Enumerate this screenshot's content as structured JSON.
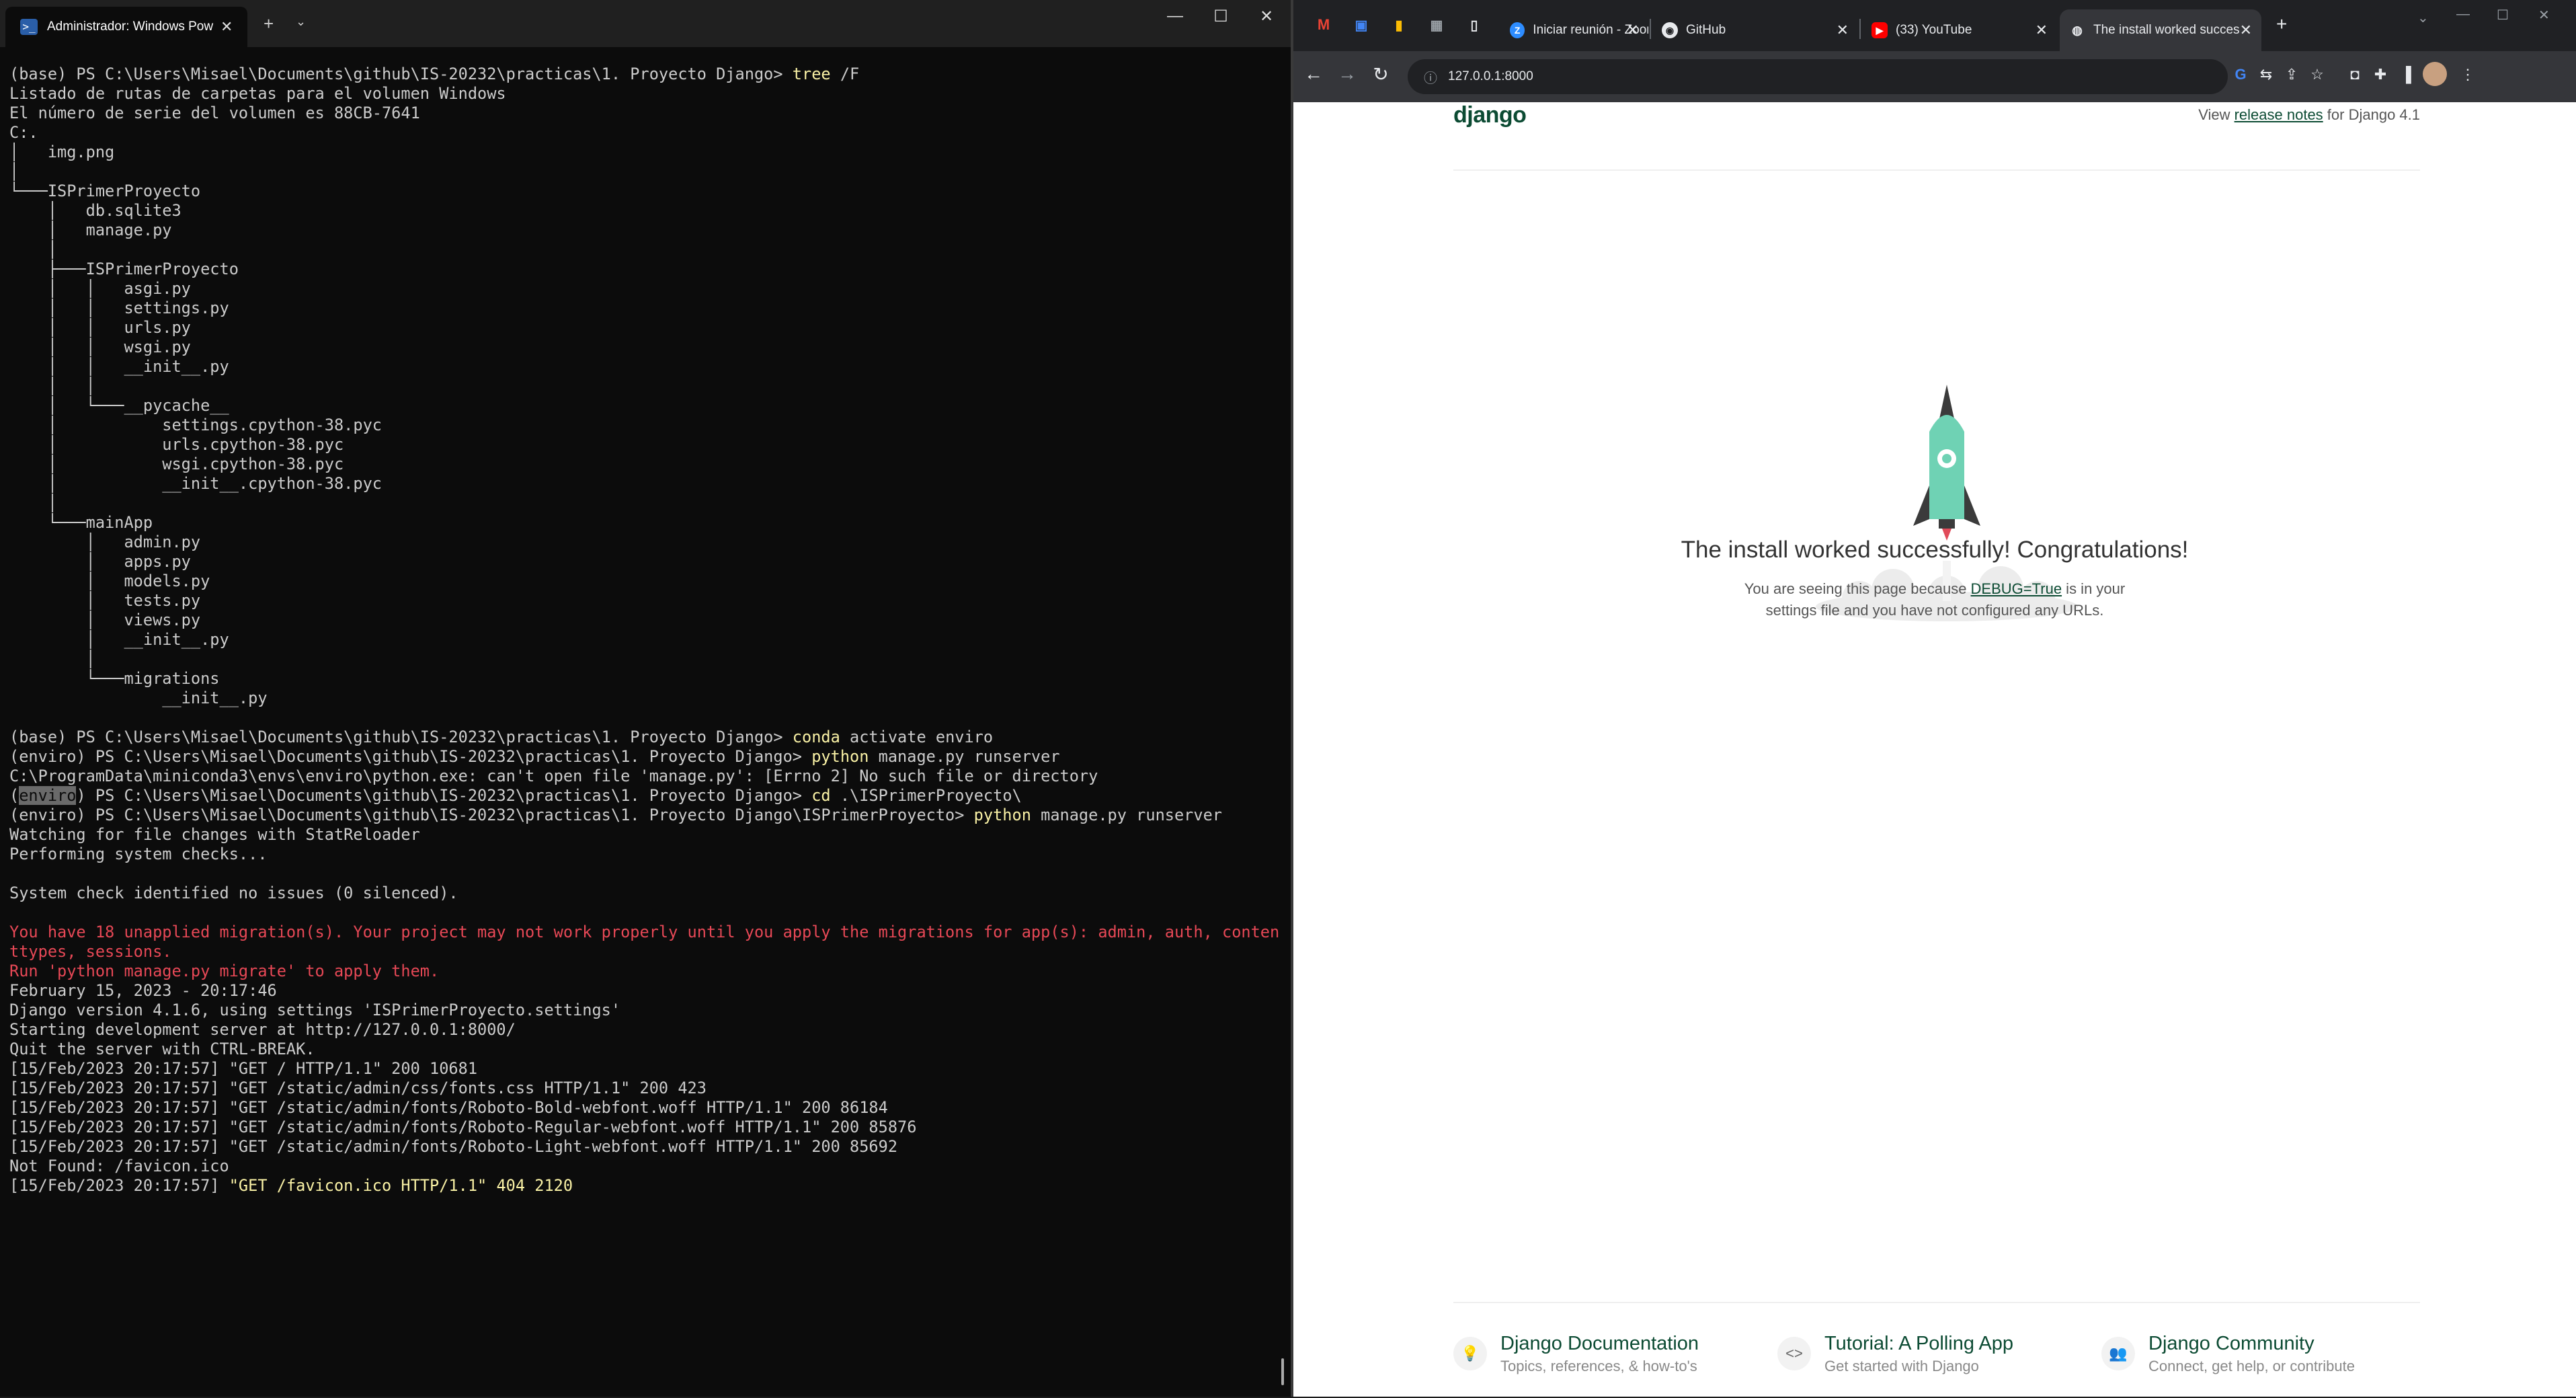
{
  "terminal": {
    "tab_title": "Administrador: Windows Pow",
    "lines": [
      [
        {
          "t": "(base) PS C:\\Users\\Misael\\Documents\\github\\IS-20232\\practicas\\1. Proyecto Django> "
        },
        {
          "t": "tree",
          "c": "c-cmd"
        },
        {
          "t": " /F"
        }
      ],
      [
        {
          "t": "Listado de rutas de carpetas para el volumen Windows"
        }
      ],
      [
        {
          "t": "El número de serie del volumen es 88CB-7641"
        }
      ],
      [
        {
          "t": "C:."
        }
      ],
      [
        {
          "t": "│   img.png"
        }
      ],
      [
        {
          "t": "│"
        }
      ],
      [
        {
          "t": "└───ISPrimerProyecto"
        }
      ],
      [
        {
          "t": "    │   db.sqlite3"
        }
      ],
      [
        {
          "t": "    │   manage.py"
        }
      ],
      [
        {
          "t": "    │"
        }
      ],
      [
        {
          "t": "    ├───ISPrimerProyecto"
        }
      ],
      [
        {
          "t": "    │   │   asgi.py"
        }
      ],
      [
        {
          "t": "    │   │   settings.py"
        }
      ],
      [
        {
          "t": "    │   │   urls.py"
        }
      ],
      [
        {
          "t": "    │   │   wsgi.py"
        }
      ],
      [
        {
          "t": "    │   │   __init__.py"
        }
      ],
      [
        {
          "t": "    │   │"
        }
      ],
      [
        {
          "t": "    │   └───__pycache__"
        }
      ],
      [
        {
          "t": "    │           settings.cpython-38.pyc"
        }
      ],
      [
        {
          "t": "    │           urls.cpython-38.pyc"
        }
      ],
      [
        {
          "t": "    │           wsgi.cpython-38.pyc"
        }
      ],
      [
        {
          "t": "    │           __init__.cpython-38.pyc"
        }
      ],
      [
        {
          "t": "    │"
        }
      ],
      [
        {
          "t": "    └───mainApp"
        }
      ],
      [
        {
          "t": "        │   admin.py"
        }
      ],
      [
        {
          "t": "        │   apps.py"
        }
      ],
      [
        {
          "t": "        │   models.py"
        }
      ],
      [
        {
          "t": "        │   tests.py"
        }
      ],
      [
        {
          "t": "        │   views.py"
        }
      ],
      [
        {
          "t": "        │   __init__.py"
        }
      ],
      [
        {
          "t": "        │"
        }
      ],
      [
        {
          "t": "        └───migrations"
        }
      ],
      [
        {
          "t": "                __init__.py"
        }
      ],
      [
        {
          "t": ""
        }
      ],
      [
        {
          "t": "(base) PS C:\\Users\\Misael\\Documents\\github\\IS-20232\\practicas\\1. Proyecto Django> "
        },
        {
          "t": "conda",
          "c": "c-cmd"
        },
        {
          "t": " activate enviro"
        }
      ],
      [
        {
          "t": "(enviro) PS C:\\Users\\Misael\\Documents\\github\\IS-20232\\practicas\\1. Proyecto Django> "
        },
        {
          "t": "python",
          "c": "c-cmd"
        },
        {
          "t": " manage.py runserver"
        }
      ],
      [
        {
          "t": "C:\\ProgramData\\miniconda3\\envs\\enviro\\python.exe: can't open file 'manage.py': [Errno 2] No such file or directory"
        }
      ],
      [
        {
          "t": "("
        },
        {
          "t": "enviro",
          "c": "hl"
        },
        {
          "t": ") PS C:\\Users\\Misael\\Documents\\github\\IS-20232\\practicas\\1. Proyecto Django> "
        },
        {
          "t": "cd",
          "c": "c-cmd"
        },
        {
          "t": " .\\ISPrimerProyecto\\"
        }
      ],
      [
        {
          "t": "(enviro) PS C:\\Users\\Misael\\Documents\\github\\IS-20232\\practicas\\1. Proyecto Django\\ISPrimerProyecto> "
        },
        {
          "t": "python",
          "c": "c-cmd"
        },
        {
          "t": " manage.py runserver"
        }
      ],
      [
        {
          "t": "Watching for file changes with StatReloader"
        }
      ],
      [
        {
          "t": "Performing system checks..."
        }
      ],
      [
        {
          "t": ""
        }
      ],
      [
        {
          "t": "System check identified no issues (0 silenced)."
        }
      ],
      [
        {
          "t": ""
        }
      ],
      [
        {
          "t": "You have 18 unapplied migration(s). Your project may not work properly until you apply the migrations for app(s): admin, auth, conten",
          "c": "c-red"
        }
      ],
      [
        {
          "t": "ttypes, sessions.",
          "c": "c-red"
        }
      ],
      [
        {
          "t": "Run 'python manage.py migrate' to apply them.",
          "c": "c-red"
        }
      ],
      [
        {
          "t": "February 15, 2023 - 20:17:46"
        }
      ],
      [
        {
          "t": "Django version 4.1.6, using settings 'ISPrimerProyecto.settings'"
        }
      ],
      [
        {
          "t": "Starting development server at http://127.0.0.1:8000/"
        }
      ],
      [
        {
          "t": "Quit the server with CTRL-BREAK."
        }
      ],
      [
        {
          "t": "[15/Feb/2023 20:17:57] \"GET / HTTP/1.1\" 200 10681"
        }
      ],
      [
        {
          "t": "[15/Feb/2023 20:17:57] \"GET /static/admin/css/fonts.css HTTP/1.1\" 200 423"
        }
      ],
      [
        {
          "t": "[15/Feb/2023 20:17:57] \"GET /static/admin/fonts/Roboto-Bold-webfont.woff HTTP/1.1\" 200 86184"
        }
      ],
      [
        {
          "t": "[15/Feb/2023 20:17:57] \"GET /static/admin/fonts/Roboto-Regular-webfont.woff HTTP/1.1\" 200 85876"
        }
      ],
      [
        {
          "t": "[15/Feb/2023 20:17:57] \"GET /static/admin/fonts/Roboto-Light-webfont.woff HTTP/1.1\" 200 85692"
        }
      ],
      [
        {
          "t": "Not Found: /favicon.ico"
        }
      ],
      [
        {
          "t": "[15/Feb/2023 20:17:57] "
        },
        {
          "t": "\"GET /favicon.ico HTTP/1.1\" 404 2120",
          "c": "c-yellow"
        }
      ]
    ]
  },
  "browser": {
    "tabs": [
      {
        "label": "Iniciar reunión - Zoom",
        "icon": "zoom-icon",
        "color": "#2d8cff"
      },
      {
        "label": "GitHub",
        "icon": "github-icon",
        "color": "#ffffff"
      },
      {
        "label": "(33) YouTube",
        "icon": "youtube-icon",
        "color": "#ff0000"
      },
      {
        "label": "The install worked succes",
        "icon": "globe-icon",
        "color": "#e8eaed"
      }
    ],
    "url": "127.0.0.1:8000"
  },
  "django": {
    "logo": "django",
    "notes_prefix": "View ",
    "notes_link": "release notes",
    "notes_suffix": " for Django 4.1",
    "title": "The install worked successfully! Congratulations!",
    "sub_prefix": "You are seeing this page because ",
    "sub_link": "DEBUG=True",
    "sub_mid": " is in your",
    "sub_line2": "settings file and you have not configured any URLs.",
    "footer": [
      {
        "title": "Django Documentation",
        "desc": "Topics, references, & how-to's",
        "icon": "lightbulb-icon"
      },
      {
        "title": "Tutorial: A Polling App",
        "desc": "Get started with Django",
        "icon": "code-icon"
      },
      {
        "title": "Django Community",
        "desc": "Connect, get help, or contribute",
        "icon": "community-icon"
      }
    ]
  }
}
